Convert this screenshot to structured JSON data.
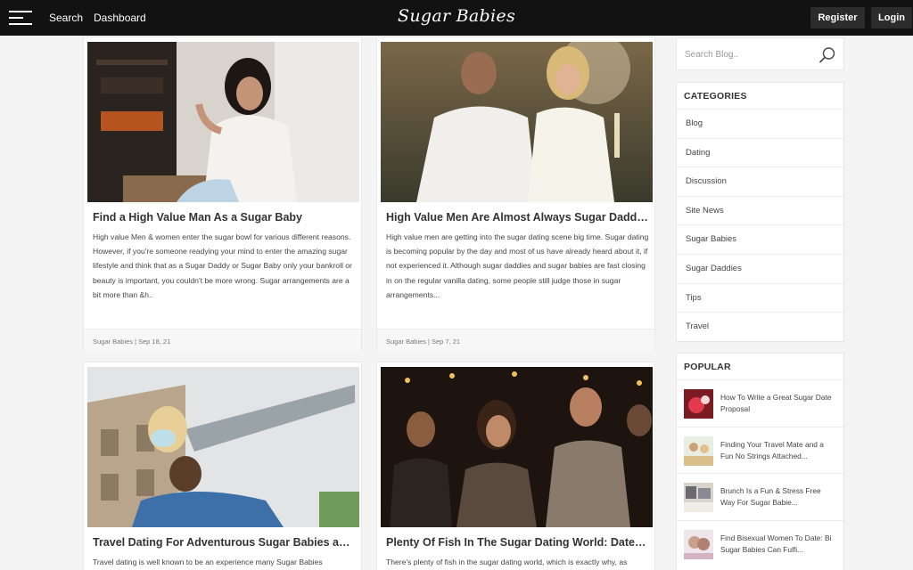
{
  "header": {
    "search_label": "Search",
    "dashboard_label": "Dashboard",
    "logo_text": "Sugar Babies",
    "register_label": "Register",
    "login_label": "Login"
  },
  "posts": [
    {
      "title": "Find a High Value Man As a Sugar Baby",
      "excerpt": "High value Men & women enter the sugar bowl for various different reasons. However, if you're someone readying your mind to enter the amazing sugar lifestyle and think that as a Sugar Daddy or Sugar Baby only your bankroll or beauty is important, you couldn't be more wrong. Sugar arrangements are a bit more than &h..",
      "category": "Sugar Babies",
      "date": "Sep 18, 21"
    },
    {
      "title": "High Value Men Are Almost Always Sugar Daddies",
      "excerpt": "High value men are getting into the sugar dating scene big time. Sugar dating is becoming popular by the day and most of us have already heard about it, if not experienced it. Although sugar daddies and sugar babies are fast closing in on the regular vanilla dating, some people still judge those in sugar arrangements...",
      "category": "Sugar Babies",
      "date": "Sep 7, 21"
    },
    {
      "title": "Travel Dating For Adventurous Sugar Babies and...",
      "excerpt": "Travel dating is well known to be an experience many Sugar Babies"
    },
    {
      "title": "Plenty Of Fish In The Sugar Dating World: Dates ...",
      "excerpt": "There's plenty of fish in the sugar dating world, which is exactly why, as"
    }
  ],
  "sidebar": {
    "search_placeholder": "Search Blog..",
    "categories_title": "CATEGORIES",
    "categories": [
      "Blog",
      "Dating",
      "Discussion",
      "Site News",
      "Sugar Babies",
      "Sugar Daddies",
      "Tips",
      "Travel"
    ],
    "popular_title": "POPULAR",
    "popular": [
      {
        "title": "How To Write a Great Sugar Date Proposal"
      },
      {
        "title": "Finding Your Travel Mate and a Fun No Strings Attached..."
      },
      {
        "title": "Brunch Is a Fun & Stress Free Way For Sugar Babie..."
      },
      {
        "title": "Find Bisexual Women To Date: Bi Sugar Babies Can Fulfi..."
      }
    ]
  },
  "colors": {
    "header_bg": "#121212",
    "page_bg": "#f4f4f4",
    "button_bg": "#2c2c2c"
  }
}
